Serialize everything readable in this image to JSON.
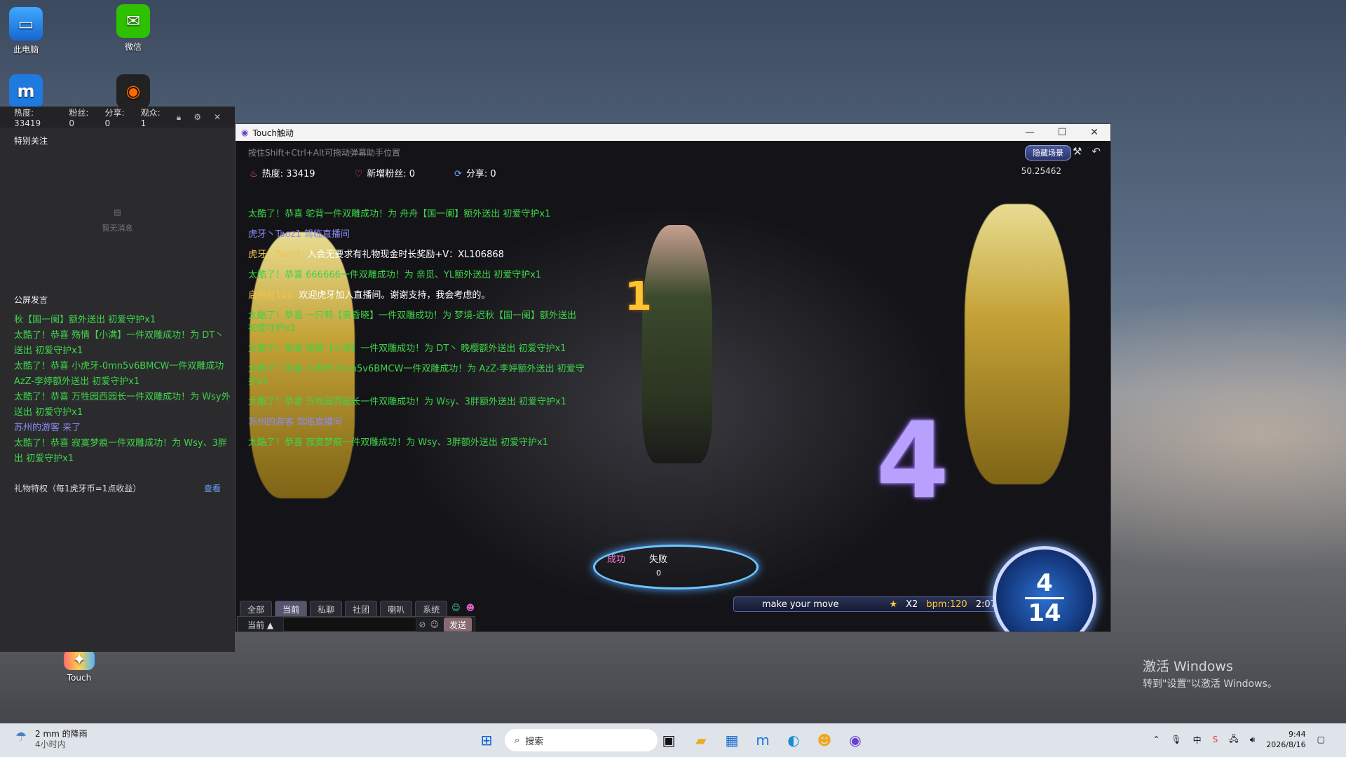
{
  "desktop": {
    "icons": [
      {
        "label": "此电脑"
      },
      {
        "label": "微信"
      },
      {
        "label": ""
      },
      {
        "label": ""
      },
      {
        "label": "Touch"
      }
    ]
  },
  "assistant": {
    "stats": {
      "heat": "热度: 33419",
      "fans": "粉丝: 0",
      "share": "分享: 0",
      "viewers": "观众: 1"
    },
    "special_follow": "特别关注",
    "empty_text": "暂无消息",
    "public_speech": "公屏发言",
    "messages": [
      "秋【国一阑】额外送出 初爱守护x1",
      "太酷了！恭喜 殇情【小满】一件双雕成功！为 DT丶送出 初爱守护x1",
      "太酷了！恭喜 小虎牙-0mn5v6BMCW一件双雕成功 AzZ-李婷额外送出 初爱守护x1",
      "太酷了！恭喜 万牲园西园长一件双雕成功！为 Wsy外送出 初爱守护x1",
      "苏州的游客 来了",
      "太酷了！恭喜 寂寞梦痕一件双雕成功！为 Wsy、3胖出 初爱守护x1"
    ],
    "privilege": "礼物特权（每1虎牙币=1点收益）",
    "look": "查看"
  },
  "game": {
    "title": "Touch触动",
    "hint": "按住Shift+Ctrl+Alt可拖动弹幕助手位置",
    "heat": "热度: 33419",
    "new_fans": "新增粉丝: 0",
    "share": "分享: 0",
    "hide_scene": "隐藏场景",
    "timer": "50.25462",
    "chat": [
      {
        "text": "太酷了！恭喜 鸵背一件双雕成功！为 舟舟【国一阑】额外送出 初爱守护x1",
        "kind": "gift"
      },
      {
        "text": "虎牙丶Taoz1 驾临直播间",
        "kind": "join"
      },
      {
        "nick": "虎牙丶Taoz1:",
        "text": " 入会无要求有礼物现金时长奖励+V：XL106868",
        "kind": "sys"
      },
      {
        "text": "太酷了！恭喜 666666一件双雕成功！为 亲觅、YL额外送出 初爱守护x1",
        "kind": "gift"
      },
      {
        "nick": "启明星110:",
        "text": " 欢迎虎牙加入直播间。谢谢支持，我会考虑的。",
        "kind": "sys"
      },
      {
        "text": "太酷了！恭喜 一只鸭【黄昏晓】一件双雕成功！为 梦境-迟秋【国一阑】额外送出 初爱守护x1",
        "kind": "gift"
      },
      {
        "text": "太酷了！恭喜 殇情【小满】一件双雕成功！为 DT丶 晚樱额外送出 初爱守护x1",
        "kind": "gift"
      },
      {
        "text": "太酷了！恭喜 小虎牙-0mn5v6BMCW一件双雕成功！为 AzZ-李婷额外送出 初爱守护x1",
        "kind": "gift"
      },
      {
        "text": "太酷了！恭喜 万牲园西园长一件双雕成功！为 Wsy、3胖额外送出 初爱守护x1",
        "kind": "gift"
      },
      {
        "text": "苏州的游客 驾临直播间",
        "kind": "join"
      },
      {
        "text": "太酷了！恭喜 寂寞梦痕一件双雕成功！为 Wsy、3胖额外送出 初爱守护x1",
        "kind": "gift"
      }
    ],
    "big_number": "4",
    "combo_num": "1",
    "judge_success": "成功",
    "judge_fail": "失败",
    "judge_count": "0",
    "move_text": "make your move",
    "multiplier": "X2",
    "bpm": "bpm:120",
    "time": "2:07",
    "counter_top": "4",
    "counter_bottom": "14",
    "tabs": [
      "全部",
      "当前",
      "私聊",
      "社团",
      "喇叭",
      "系统"
    ],
    "input_channel": "当前",
    "send": "发送"
  },
  "taskbar": {
    "weather_line1": "2 mm 的降雨",
    "weather_line2": "4小时内",
    "search_placeholder": "搜索",
    "time": "9:44",
    "date": "2026/8/16"
  },
  "activation": {
    "line1": "激活 Windows",
    "line2": "转到\"设置\"以激活 Windows。"
  }
}
